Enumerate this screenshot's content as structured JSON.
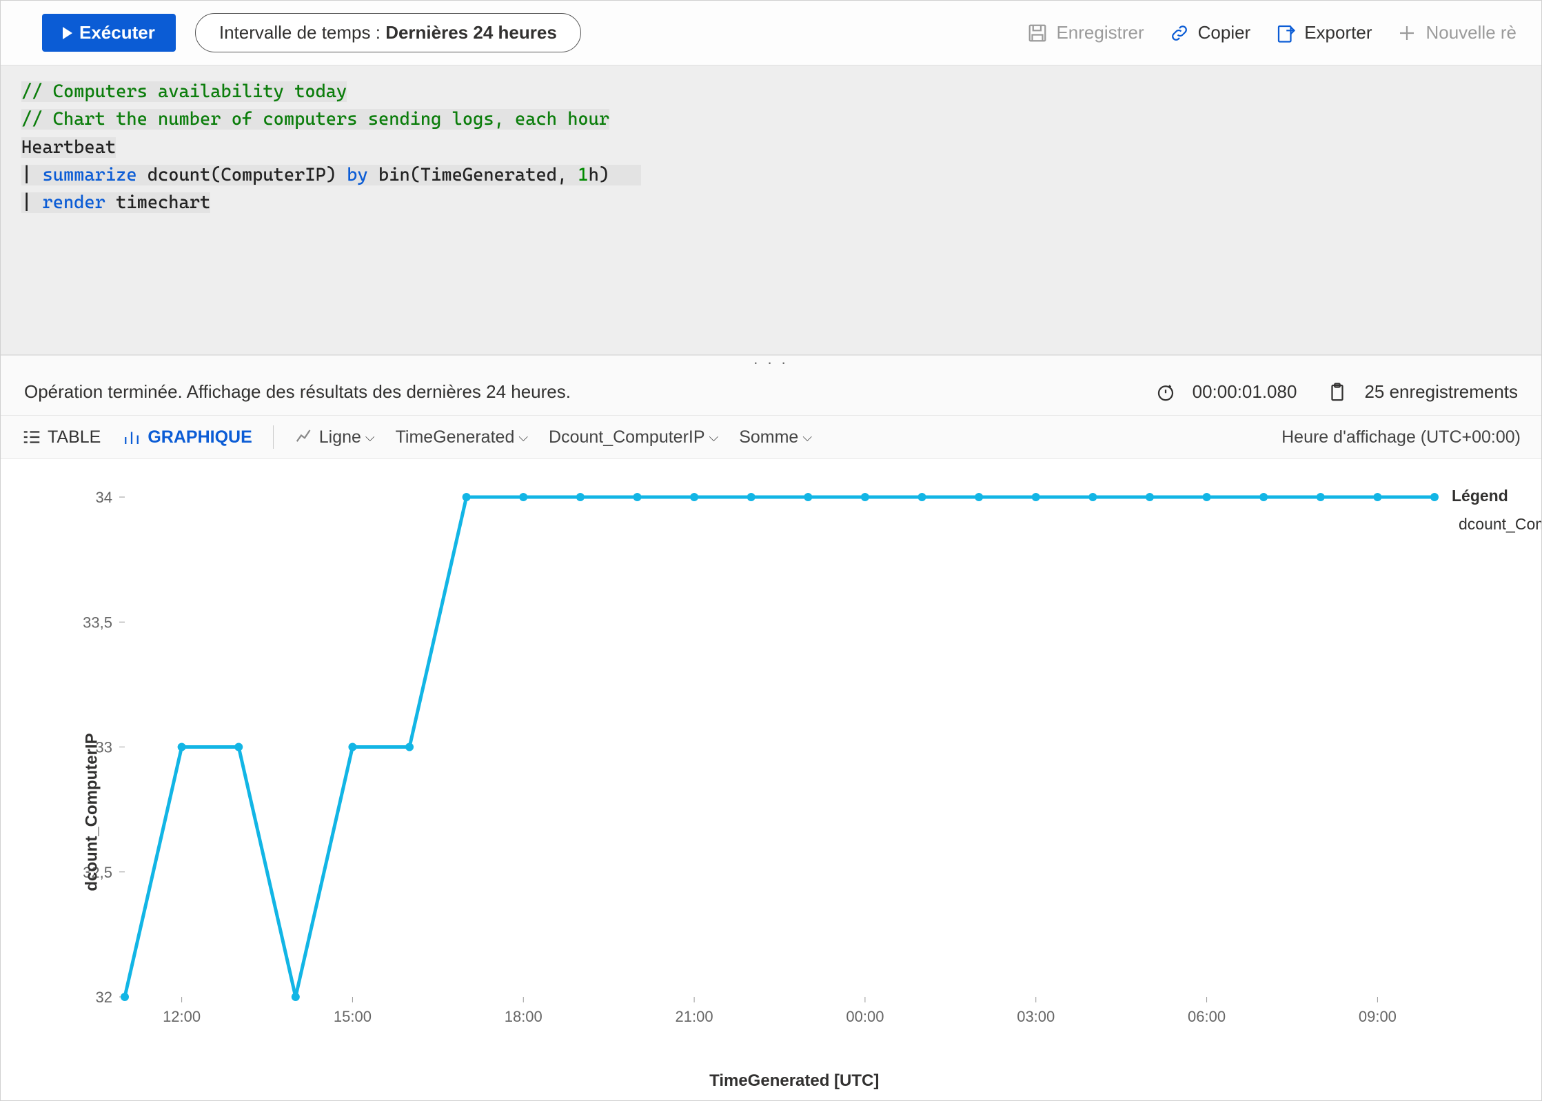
{
  "toolbar": {
    "run_label": "Exécuter",
    "time_prefix": "Intervalle de temps : ",
    "time_value": "Dernières 24 heures",
    "save_label": "Enregistrer",
    "copy_label": "Copier",
    "export_label": "Exporter",
    "new_rule_label": "Nouvelle rè"
  },
  "editor": {
    "line1": "// Computers availability today",
    "line2": "// Chart the number of computers sending logs, each hour",
    "line3": "Heartbeat",
    "line4_pipe": "| ",
    "line4_kw1": "summarize",
    "line4_mid": " dcount(ComputerIP) ",
    "line4_kw2": "by",
    "line4_mid2": " bin(TimeGenerated, ",
    "line4_num": "1",
    "line4_tail": "h)",
    "line5_pipe": "| ",
    "line5_kw": "render",
    "line5_tail": " timechart"
  },
  "status": {
    "message": "Opération terminée. Affichage des résultats des dernières 24 heures.",
    "elapsed": "00:00:01.080",
    "records": "25 enregistrements"
  },
  "viewbar": {
    "table_label": "TABLE",
    "chart_label": "GRAPHIQUE",
    "chart_type": "Ligne",
    "x_field": "TimeGenerated",
    "y_field": "Dcount_ComputerIP",
    "agg": "Somme",
    "tz_label": "Heure d'affichage (UTC+00:00)"
  },
  "chart": {
    "y_title": "dcount_ComputerIP",
    "x_title": "TimeGenerated [UTC]",
    "legend_title": "Légend",
    "legend_series": "dcount_Compu"
  },
  "chart_data": {
    "type": "line",
    "ylabel": "dcount_ComputerIP",
    "xlabel": "TimeGenerated [UTC]",
    "ylim": [
      32,
      34
    ],
    "y_ticks": [
      "32",
      "32,5",
      "33",
      "33,5",
      "34"
    ],
    "x_ticks": [
      "12:00",
      "15:00",
      "18:00",
      "21:00",
      "00:00",
      "03:00",
      "06:00",
      "09:00"
    ],
    "x": [
      "11:00",
      "12:00",
      "13:00",
      "14:00",
      "15:00",
      "16:00",
      "17:00",
      "18:00",
      "19:00",
      "20:00",
      "21:00",
      "22:00",
      "23:00",
      "00:00",
      "01:00",
      "02:00",
      "03:00",
      "04:00",
      "05:00",
      "06:00",
      "07:00",
      "08:00",
      "09:00",
      "10:00"
    ],
    "series": [
      {
        "name": "dcount_ComputerIP",
        "values": [
          32,
          33,
          33,
          32,
          33,
          33,
          34,
          34,
          34,
          34,
          34,
          34,
          34,
          34,
          34,
          34,
          34,
          34,
          34,
          34,
          34,
          34,
          34,
          34
        ]
      }
    ]
  }
}
